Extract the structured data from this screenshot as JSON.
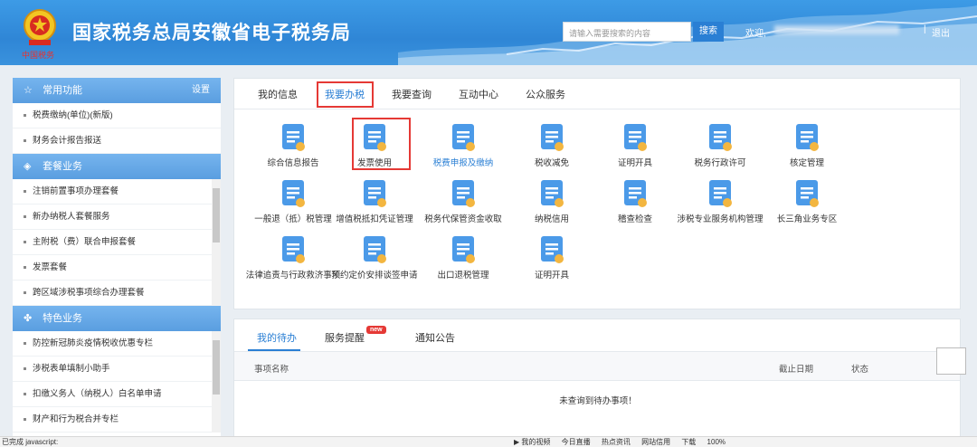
{
  "header": {
    "subtext": "中国税务",
    "title": "国家税务总局安徽省电子税务局",
    "search_placeholder": "请输入需要搜索的内容",
    "search_button": "搜索",
    "welcome": "欢迎,",
    "separator": "|",
    "logout": "退出"
  },
  "sidebar": {
    "sections": [
      {
        "title": "常用功能",
        "icon": "star-icon",
        "settings": "设置",
        "items": [
          "税费缴纳(单位)(新版)",
          "财务会计报告报送"
        ]
      },
      {
        "title": "套餐业务",
        "icon": "layers-icon",
        "items": [
          "注销前置事项办理套餐",
          "新办纳税人套餐服务",
          "主附税（费）联合申报套餐",
          "发票套餐",
          "跨区域涉税事项综合办理套餐"
        ]
      },
      {
        "title": "特色业务",
        "icon": "clover-icon",
        "items": [
          "防控新冠肺炎疫情税收优惠专栏",
          "涉税表单填制小助手",
          "扣缴义务人（纳税人）白名单申请",
          "财产和行为税合并专栏"
        ]
      }
    ]
  },
  "main_tabs": [
    "我的信息",
    "我要办税",
    "我要查询",
    "互动中心",
    "公众服务"
  ],
  "functions": [
    {
      "label": "综合信息报告",
      "icon": "report-icon"
    },
    {
      "label": "发票使用",
      "icon": "invoice-icon"
    },
    {
      "label": "税费申报及缴纳",
      "icon": "declare-icon"
    },
    {
      "label": "税收减免",
      "icon": "tax-relief-icon"
    },
    {
      "label": "证明开具",
      "icon": "certificate-icon"
    },
    {
      "label": "税务行政许可",
      "icon": "license-icon"
    },
    {
      "label": "核定管理",
      "icon": "verify-user-icon"
    },
    {
      "label": "一般退（抵）税管理",
      "icon": "refund-icon"
    },
    {
      "label": "增值税抵扣凭证管理",
      "icon": "vat-deduction-icon"
    },
    {
      "label": "税务代保管资金收取",
      "icon": "custody-icon"
    },
    {
      "label": "纳税信用",
      "icon": "credit-icon"
    },
    {
      "label": "稽查检查",
      "icon": "inspection-icon"
    },
    {
      "label": "涉税专业服务机构管理",
      "icon": "agency-icon"
    },
    {
      "label": "长三角业务专区",
      "icon": "yangtze-icon"
    },
    {
      "label": "法律追责与行政救济事项",
      "icon": "legal-icon"
    },
    {
      "label": "预约定价安排谈签申请",
      "icon": "pricing-icon"
    },
    {
      "label": "出口退税管理",
      "icon": "export-refund-icon"
    },
    {
      "label": "证明开具",
      "icon": "certificate2-icon"
    }
  ],
  "todo": {
    "tabs": [
      "我的待办",
      "服务提醒",
      "通知公告"
    ],
    "new_badge": "new",
    "columns": [
      "事项名称",
      "截止日期",
      "状态"
    ],
    "empty": "未查询到待办事项！"
  },
  "statusbar": {
    "left": "已完成 javascript:",
    "items": [
      "▶ 我的视频",
      "今日直播",
      "热点资讯",
      "网站信用",
      "下载",
      "100%"
    ]
  },
  "colors": {
    "accent": "#2a7fd4",
    "highlight": "#e53935",
    "sidebar_head": "#5a9ee0"
  }
}
